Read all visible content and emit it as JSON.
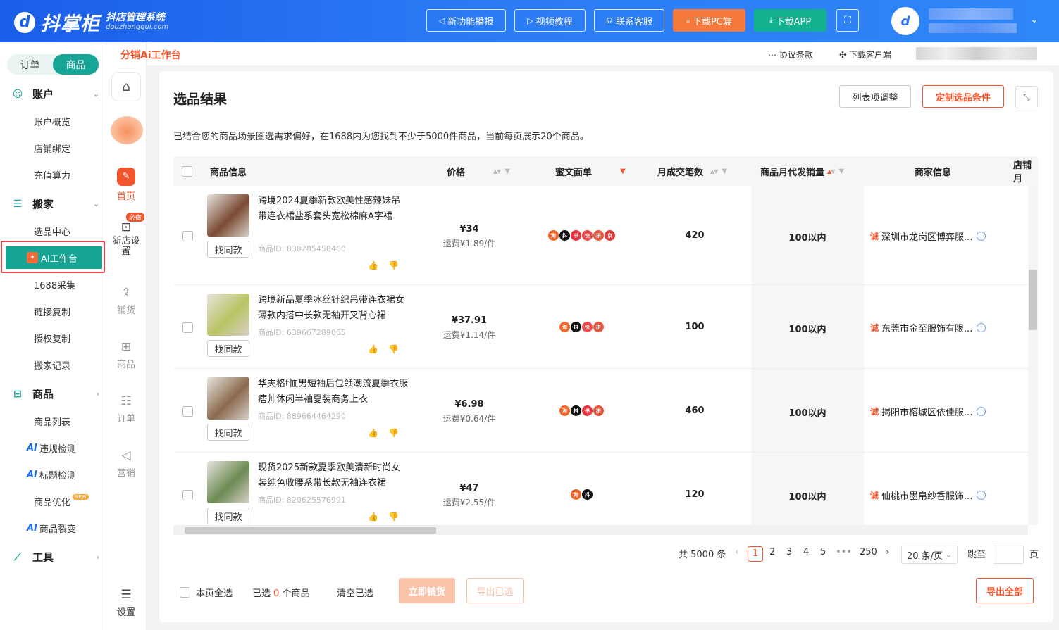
{
  "topbar": {
    "logo_mark": "d",
    "logo_name": "抖掌柜",
    "logo_tagline": "抖店管理系统",
    "logo_domain": "douzhanggui.com",
    "buttons": [
      "新功能播报",
      "视频教程",
      "联系客服",
      "下载PC端",
      "下载APP"
    ],
    "colors": {
      "bar": "#2b7bf5",
      "download_pc": "#f4793b",
      "download_app": "#13b28e"
    }
  },
  "sidebar": {
    "tabs": [
      "订单",
      "商品"
    ],
    "active_tab": "商品",
    "groups": [
      {
        "label": "账户",
        "items": [
          "账户概览",
          "店铺绑定",
          "充值算力"
        ]
      },
      {
        "label": "搬家",
        "items": [
          "选品中心",
          "AI工作台",
          "1688采集",
          "链接复制",
          "授权复制",
          "搬家记录"
        ]
      },
      {
        "label": "商品",
        "items": [
          "商品列表",
          "违规检测",
          "标题检测",
          "商品优化",
          "商品裂变"
        ]
      },
      {
        "label": "工具",
        "items": []
      }
    ],
    "ai_prefix": "AI",
    "new_badge": "NEW",
    "accent": "#16a595"
  },
  "rail": {
    "items": [
      "首页",
      "新店设置",
      "铺货",
      "商品",
      "订单",
      "营销",
      "设置"
    ],
    "must_badge": "必做"
  },
  "crumb": {
    "title": "分销Ai工作台",
    "links": [
      "协议条款",
      "下载客户端"
    ]
  },
  "main": {
    "title": "选品结果",
    "description": "已结合您的商品场景圈选需求偏好，在1688内为您找到不少于5000件商品，当前每页展示20个商品。",
    "btn_columns": "列表项调整",
    "btn_custom": "定制选品条件",
    "columns": [
      "商品信息",
      "价格",
      "蜜文面单",
      "月成交笔数",
      "商品月代发销量",
      "商家信息",
      "店铺月"
    ],
    "find_same": "找同款",
    "rows": [
      {
        "title": "跨境2024夏季新款欧美性感辣妹吊带连衣裙盐系套头宽松棉麻A字裙",
        "id": "商品ID: 838285458460",
        "price": "¥34",
        "shipping": "运费¥1.89/件",
        "platforms": [
          "淘",
          "抖",
          "书",
          "快",
          "拼",
          "京"
        ],
        "orders": "420",
        "sales": "100以内",
        "merchant": "深圳市龙岗区博弈服..."
      },
      {
        "title": "跨境新品夏季冰丝针织吊带连衣裙女薄款内搭中长款无袖开叉背心裙",
        "id": "商品ID: 639667289065",
        "price": "¥37.91",
        "shipping": "运费¥1.14/件",
        "platforms": [
          "淘",
          "抖",
          "快",
          "拼"
        ],
        "orders": "100",
        "sales": "100以内",
        "merchant": "东莞市金至服饰有限..."
      },
      {
        "title": "华夫格t恤男短袖后包领潮流夏季衣服痞帅休闲半袖夏装商务上衣",
        "id": "商品ID: 889664464290",
        "price": "¥6.98",
        "shipping": "运费¥0.64/件",
        "platforms": [
          "淘",
          "抖",
          "书",
          "拼"
        ],
        "orders": "460",
        "sales": "100以内",
        "merchant": "揭阳市榕城区依佳服..."
      },
      {
        "title": "现货2025新款夏季欧美清新时尚女装纯色收腰系带长款无袖连衣裙",
        "id": "商品ID: 820625576991",
        "price": "¥47",
        "shipping": "运费¥2.55/件",
        "platforms": [
          "淘",
          "抖"
        ],
        "orders": "120",
        "sales": "100以内",
        "merchant": "仙桃市墨帛纱香服饰..."
      }
    ],
    "merchant_prefix": "诚",
    "thumb_colors": [
      "#7a4a33",
      "#b9c264",
      "#8a6a4d",
      "#6b8a52"
    ],
    "platform_colors": {
      "淘": "#f2662a",
      "抖": "#111111",
      "书": "#e8353f",
      "快": "#f24a4a",
      "拼": "#e9573f",
      "京": "#e23a3a"
    }
  },
  "pagination": {
    "total": "共 5000 条",
    "pages": [
      "1",
      "2",
      "3",
      "4",
      "5",
      "250"
    ],
    "current": "1",
    "ellipsis": "•••",
    "page_size": "20 条/页",
    "jump": "跳至",
    "page_unit": "页"
  },
  "footer": {
    "select_page": "本页全选",
    "selected_prefix": "已选",
    "selected_count": "0",
    "selected_suffix": "个商品",
    "clear": "清空已选",
    "btn_list_now": "立即铺货",
    "btn_export_selected": "导出已选",
    "btn_export_all": "导出全部"
  }
}
